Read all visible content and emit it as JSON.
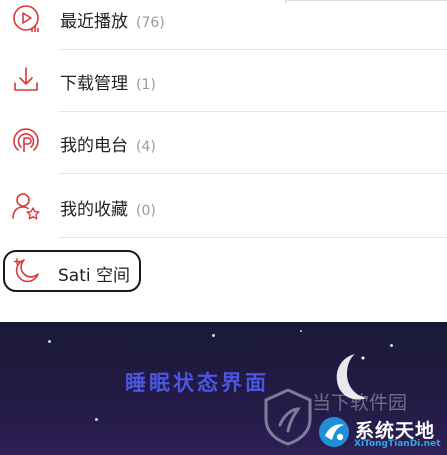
{
  "menu": {
    "items": [
      {
        "label": "最近播放",
        "count": "(76)",
        "icon": "recent-play-icon"
      },
      {
        "label": "下载管理",
        "count": "(1)",
        "icon": "download-icon"
      },
      {
        "label": "我的电台",
        "count": "(4)",
        "icon": "radio-icon"
      },
      {
        "label": "我的收藏",
        "count": "(0)",
        "icon": "favorites-icon"
      }
    ],
    "sati": {
      "label": "Sati 空间",
      "icon": "sati-moon-icon"
    }
  },
  "sleep_panel": {
    "title": "睡眠状态界面"
  },
  "watermark": {
    "line1": "当下软件园",
    "line2": "系统天地",
    "line3": "XiTongTianDi.net"
  },
  "colors": {
    "accent": "#d9393b",
    "sleep_bg": "#231a45",
    "sleep_title": "#4a55e0"
  }
}
